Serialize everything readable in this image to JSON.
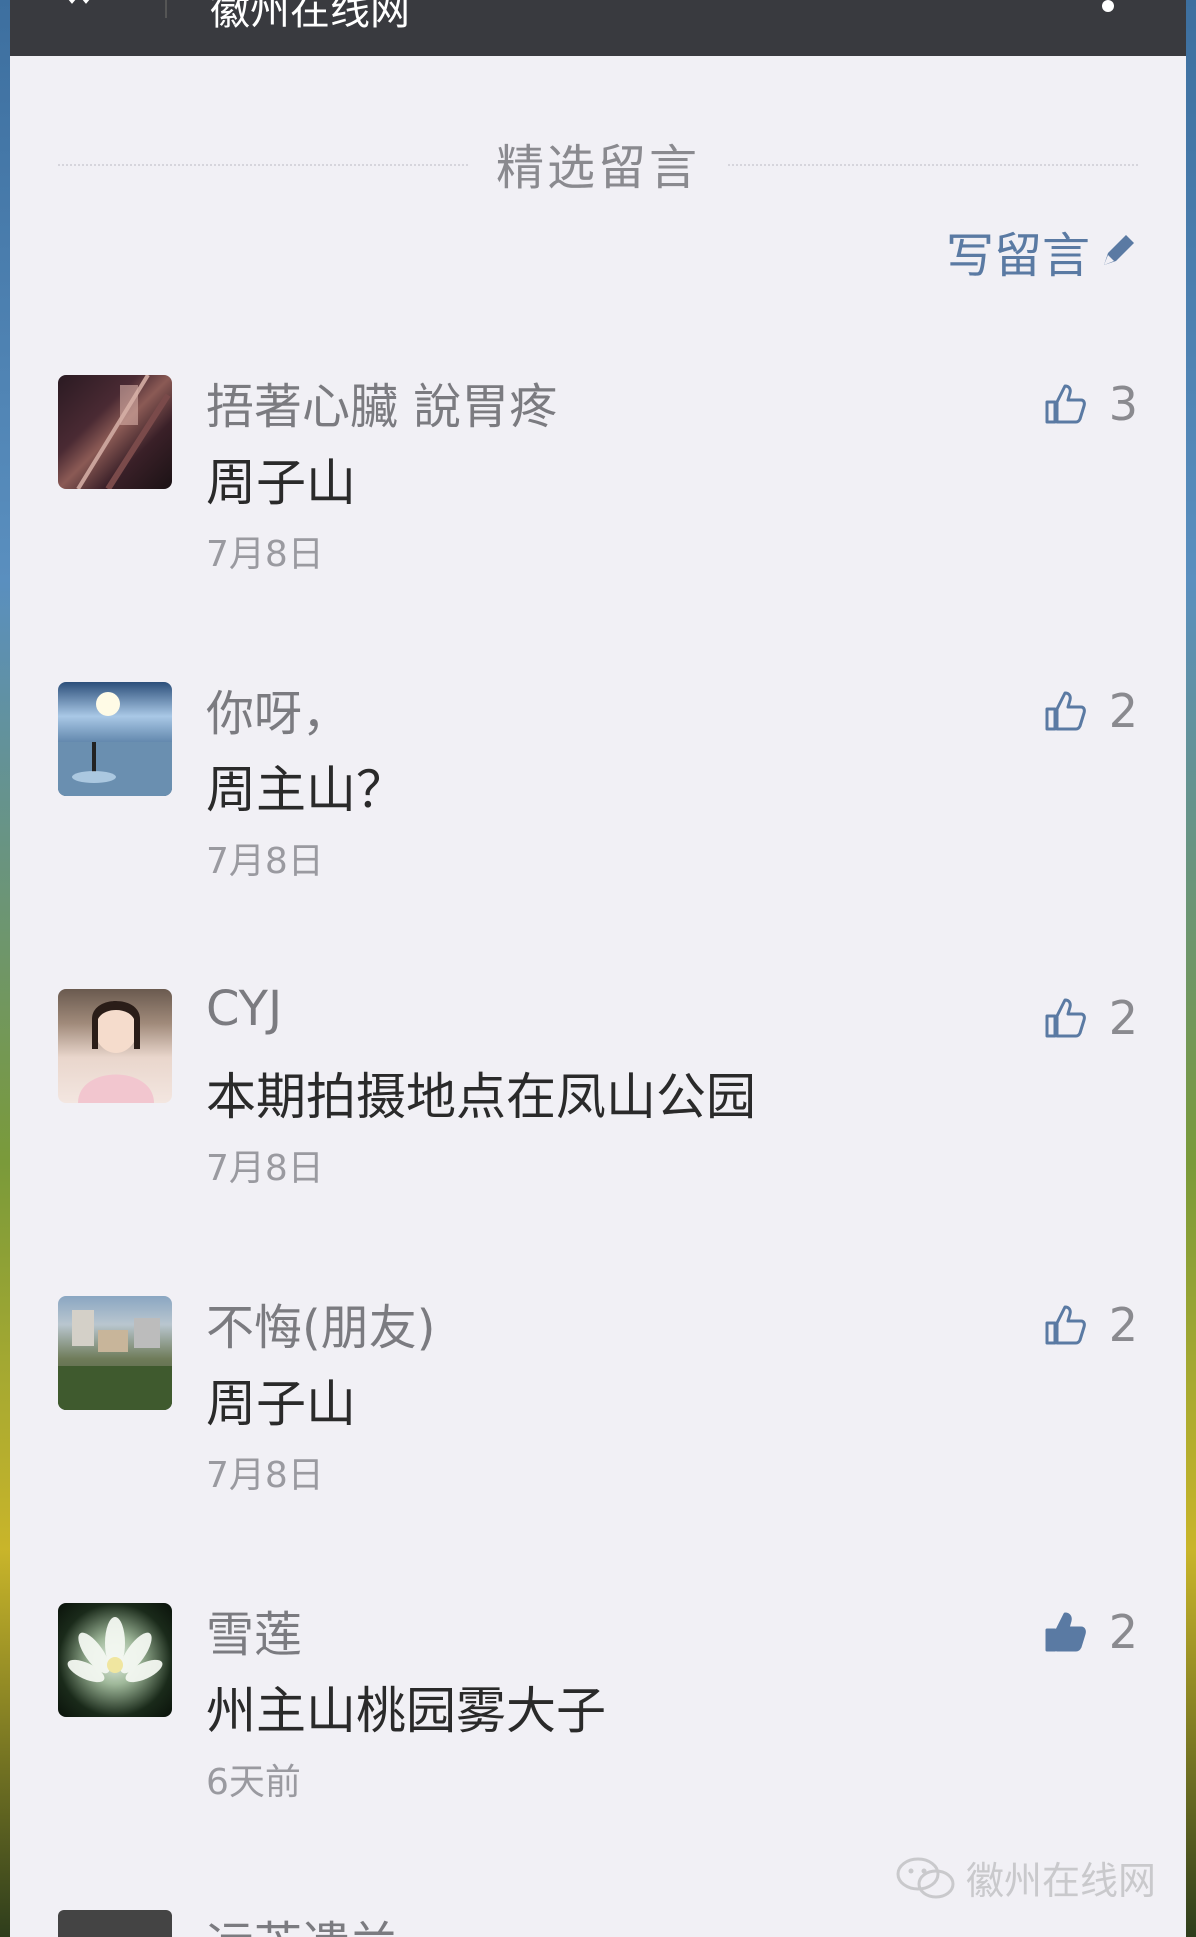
{
  "header": {
    "title": "徽州在线网"
  },
  "section": {
    "title": "精选留言"
  },
  "write_button": {
    "label": "写留言"
  },
  "comments": [
    {
      "nickname": "捂著心臟 說胃疼",
      "text": "周子山",
      "time": "7月8日",
      "likes": "3",
      "liked": false,
      "avatar": "avatar-dark"
    },
    {
      "nickname": "你呀，",
      "text": "周主山？",
      "time": "7月8日",
      "likes": "2",
      "liked": false,
      "avatar": "avatar-sky"
    },
    {
      "nickname": "CYJ",
      "text": "本期拍摄地点在凤山公园",
      "time": "7月8日",
      "likes": "2",
      "liked": false,
      "avatar": "avatar-portrait"
    },
    {
      "nickname": "不悔(朋友)",
      "text": "周子山",
      "time": "7月8日",
      "likes": "2",
      "liked": false,
      "avatar": "avatar-town"
    },
    {
      "nickname": "雪莲",
      "text": "州主山桃园雾大子",
      "time": "6天前",
      "likes": "2",
      "liked": true,
      "avatar": "avatar-lotus"
    }
  ],
  "partial_comment": {
    "nickname": "远芳遗兰"
  },
  "watermark": {
    "text": "徽州在线网"
  },
  "colors": {
    "accent": "#5a7aa3",
    "topbar": "#393a3f",
    "page_bg": "#f1f0f5"
  }
}
